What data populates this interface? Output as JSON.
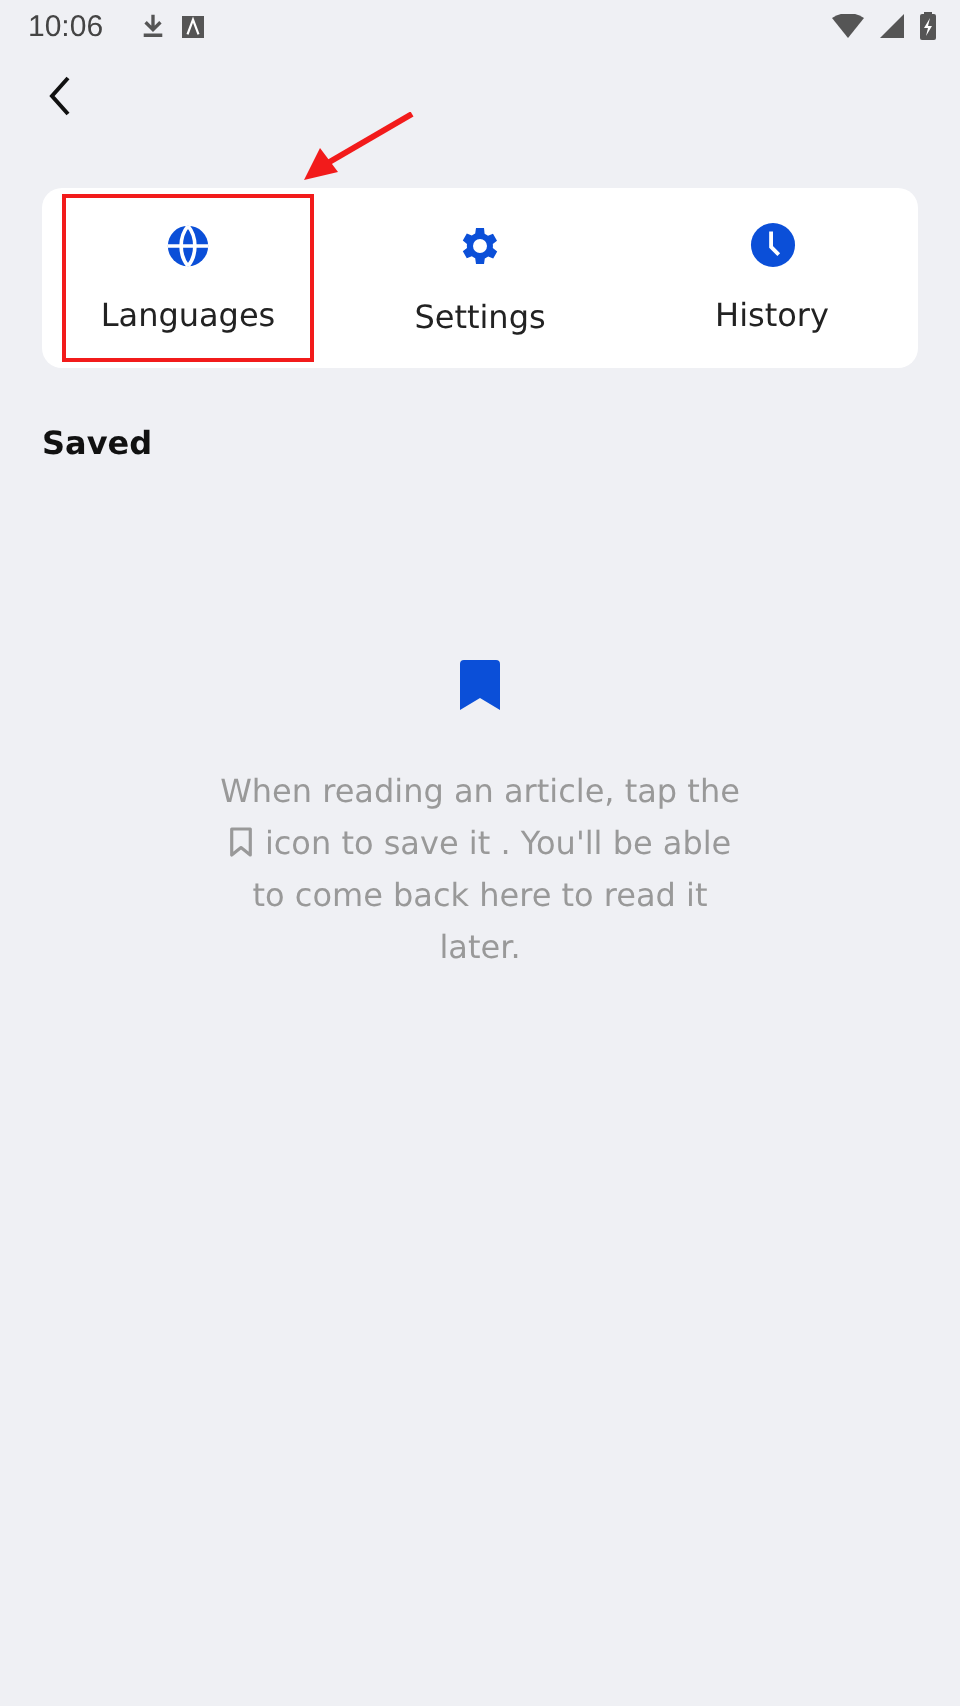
{
  "status_bar": {
    "time": "10:06"
  },
  "menu": [
    {
      "kind": "globe",
      "label": "Languages",
      "highlighted": true
    },
    {
      "kind": "gear",
      "label": "Settings",
      "highlighted": false
    },
    {
      "kind": "clock",
      "label": "History",
      "highlighted": false
    }
  ],
  "section_title": "Saved",
  "empty_message": {
    "before_icon": "When reading an article, tap the",
    "after_icon": "icon to save it . You'll be able to come back here to read it later."
  }
}
